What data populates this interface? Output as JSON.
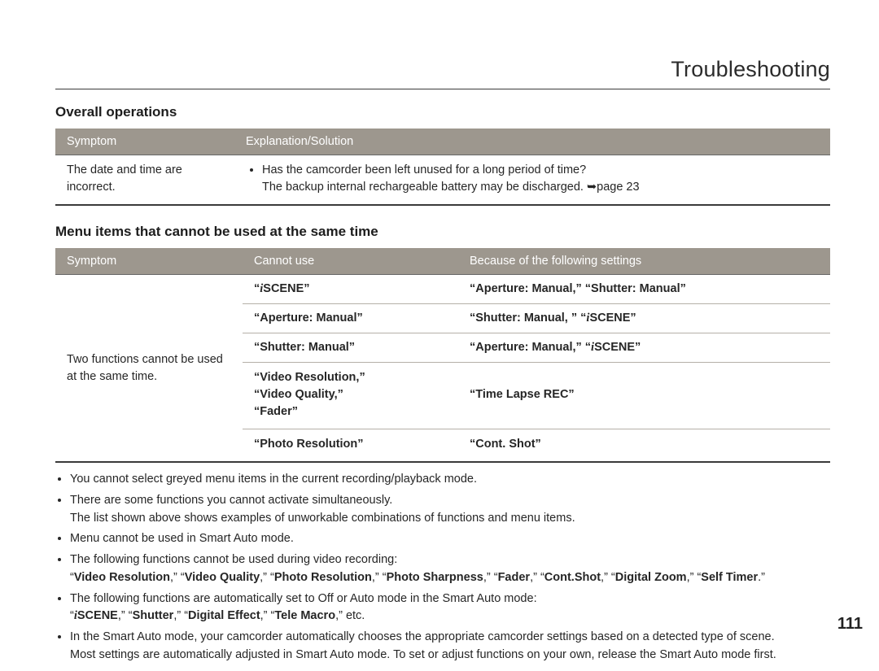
{
  "header": {
    "title": "Troubleshooting"
  },
  "section1": {
    "heading": "Overall operations",
    "columns": [
      "Symptom",
      "Explanation/Solution"
    ],
    "row": {
      "symptom": "The date and time are incorrect.",
      "bullet": "Has the camcorder been left unused for a long period of time?",
      "sub_a": "The backup internal rechargeable battery may be discharged. ",
      "sub_arrow": "➥",
      "sub_b": "page 23"
    }
  },
  "section2": {
    "heading": "Menu items that cannot be used at the same time",
    "columns": [
      "Symptom",
      "Cannot use",
      "Because of the following settings"
    ],
    "symptom": "Two functions cannot be used at the same time.",
    "rows": [
      {
        "b_pre": "“",
        "b_i": true,
        "b_mid": "SCENE”",
        "c_pre": "“Aperture: Manual,” “Shutter: Manual”",
        "c_i": false,
        "c_post": ""
      },
      {
        "b_pre": "“Aperture: Manual”",
        "b_i": false,
        "b_mid": "",
        "c_pre": "“Shutter: Manual, ” “",
        "c_i": true,
        "c_post": "SCENE”"
      },
      {
        "b_pre": "“Shutter: Manual”",
        "b_i": false,
        "b_mid": "",
        "c_pre": "“Aperture: Manual,” “",
        "c_i": true,
        "c_post": "SCENE”"
      },
      {
        "b_pre": "“Video Resolution,”\n“Video Quality,”\n“Fader”",
        "b_i": false,
        "b_mid": "",
        "c_pre": "“Time Lapse REC”",
        "c_i": false,
        "c_post": ""
      },
      {
        "b_pre": "“Photo Resolution”",
        "b_i": false,
        "b_mid": "",
        "c_pre": "“Cont. Shot”",
        "c_i": false,
        "c_post": ""
      }
    ]
  },
  "notes": {
    "n1": "You cannot select greyed menu items in the current recording/playback mode.",
    "n2a": "There are some functions you cannot activate simultaneously.",
    "n2b": "The list shown above shows examples of unworkable combinations of functions and menu items.",
    "n3": "Menu cannot be used in Smart Auto mode.",
    "n4a": "The following functions cannot be used during video recording:",
    "n4b_parts": [
      "“",
      "Video Resolution",
      ",” “",
      "Video Quality",
      ",” “",
      "Photo Resolution",
      ",” “",
      "Photo Sharpness",
      ",” “",
      "Fader",
      ",” “",
      "Cont.Shot",
      ",” “",
      "Digital Zoom",
      ",” “",
      "Self Timer",
      ".”"
    ],
    "n5a": "The following functions are automatically set to Off or Auto mode in the Smart Auto mode:",
    "n5b_parts": {
      "pre": "“",
      "scene": "SCENE",
      "mid1": ",” “",
      "shutter": "Shutter",
      "mid2": ",” “",
      "de": "Digital Effect",
      "mid3": ",” “",
      "tm": "Tele Macro",
      "post": ",” etc."
    },
    "n6a": "In the Smart Auto mode, your camcorder automatically chooses the appropriate camcorder settings based on a detected type of scene.",
    "n6b": "Most settings are automatically adjusted in Smart Auto mode. To set or adjust functions on your own, release the Smart Auto mode first."
  },
  "page_number": "111"
}
